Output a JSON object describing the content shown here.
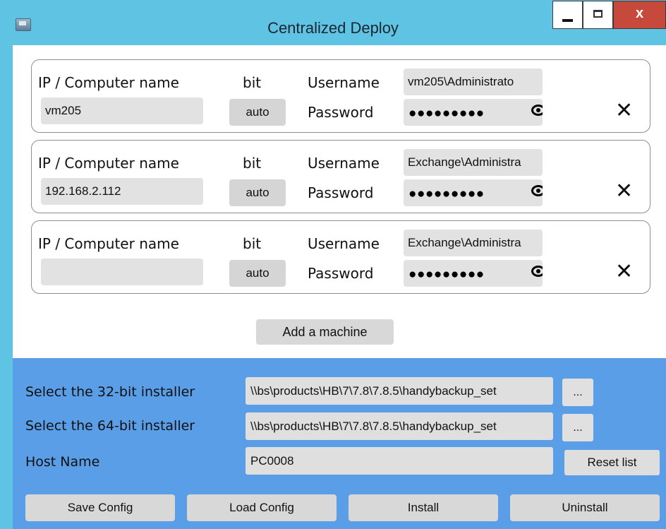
{
  "window": {
    "title": "Centralized Deploy",
    "close_glyph": "x"
  },
  "machines": [
    {
      "ip_label": "IP / Computer name",
      "ip_value": "vm205",
      "bit_label": "bit",
      "bit_value": "auto",
      "username_label": "Username",
      "username_value": "vm205\\Administrato",
      "password_label": "Password",
      "password_mask": "●●●●●●●●●"
    },
    {
      "ip_label": "IP / Computer name",
      "ip_value": "192.168.2.112",
      "bit_label": "bit",
      "bit_value": "auto",
      "username_label": "Username",
      "username_value": "Exchange\\Administra",
      "password_label": "Password",
      "password_mask": "●●●●●●●●●"
    },
    {
      "ip_label": "IP / Computer name",
      "ip_value": "",
      "bit_label": "bit",
      "bit_value": "auto",
      "username_label": "Username",
      "username_value": "Exchange\\Administra",
      "password_label": "Password",
      "password_mask": "●●●●●●●●●"
    }
  ],
  "remove_glyph": "✕",
  "add_machine_label": "Add a machine",
  "installer32": {
    "label": "Select the 32-bit installer",
    "value": "\\\\bs\\products\\HB\\7\\7.8\\7.8.5\\handybackup_set"
  },
  "installer64": {
    "label": "Select the 64-bit installer",
    "value": "\\\\bs\\products\\HB\\7\\7.8\\7.8.5\\handybackup_set"
  },
  "browse_label": "...",
  "host": {
    "label": "Host Name",
    "value": "PC0008"
  },
  "reset_list_label": "Reset list",
  "actions": {
    "save": "Save Config",
    "load": "Load Config",
    "install": "Install",
    "uninstall": "Uninstall"
  },
  "colors": {
    "titlebar": "#5fc3e4",
    "panel": "#5b9ee8",
    "close": "#c7493c",
    "field": "#e2e2e2"
  },
  "icons": {
    "app": "app-window-icon",
    "reveal": "eye-icon",
    "remove": "close-x-icon"
  }
}
